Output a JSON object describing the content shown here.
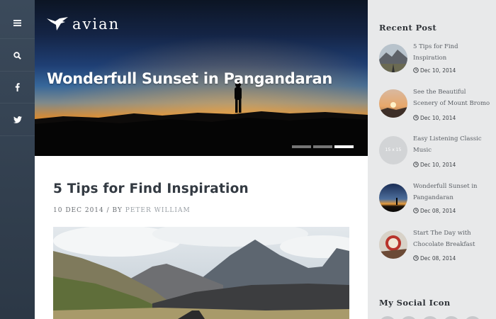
{
  "rail": {
    "icons": [
      "menu-icon",
      "search-icon",
      "facebook-icon",
      "twitter-icon"
    ]
  },
  "hero": {
    "logo_text": "avian",
    "title": "Wonderfull Sunset in Pangandaran",
    "slides": 3,
    "active_slide": 3
  },
  "post": {
    "title": "5 Tips for Find Inspiration",
    "date": "10 DEC 2014",
    "by": "/ BY",
    "author": "PETER WILLIAM"
  },
  "sidebar": {
    "recent_heading": "Recent Post",
    "social_heading": "My Social Icon",
    "recent": [
      {
        "title": "5 Tips for Find Inspiration",
        "date": "Dec 10, 2014",
        "thumb": "mountain-road"
      },
      {
        "title": "See the Beautiful Scenery of Mount Bromo",
        "date": "Dec 10, 2014",
        "thumb": "bromo-sunrise"
      },
      {
        "title": "Easy Listening Classic Music",
        "date": "Dec 10, 2014",
        "thumb": "placeholder",
        "thumb_text": "15 x 15"
      },
      {
        "title": "Wonderfull Sunset in Pangandaran",
        "date": "Dec 08, 2014",
        "thumb": "sunset"
      },
      {
        "title": "Start The Day with Chocolate Breakfast",
        "date": "Dec 08, 2014",
        "thumb": "breakfast"
      }
    ]
  },
  "colors": {
    "rail": "#334150",
    "sidebar_bg": "#e8e9ea",
    "title_text": "#333a42"
  }
}
